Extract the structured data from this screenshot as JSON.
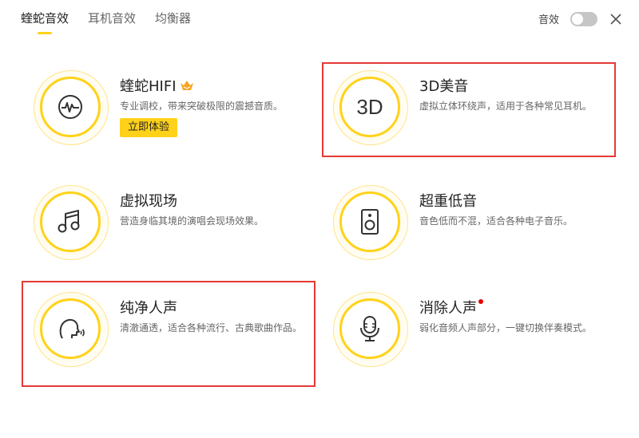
{
  "tabs": [
    {
      "label": "蝰蛇音效",
      "active": true
    },
    {
      "label": "耳机音效",
      "active": false
    },
    {
      "label": "均衡器",
      "active": false
    }
  ],
  "top_right": {
    "sound_label": "音效",
    "toggle_on": false,
    "close_icon": "close-icon"
  },
  "cards": [
    {
      "title": "蝰蛇HIFI",
      "desc": "专业调校，带来突破极限的震撼音质。",
      "icon": "waveform-icon",
      "button": "立即体验",
      "crown": "vip-crown-icon"
    },
    {
      "title": "3D美音",
      "desc": "虚拟立体环绕声，适用于各种常见耳机。",
      "icon": "3d-icon",
      "icon_text": "3D"
    },
    {
      "title": "虚拟现场",
      "desc": "营造身临其境的演唱会现场效果。",
      "icon": "music-note-icon"
    },
    {
      "title": "超重低音",
      "desc": "音色低而不混，适合各种电子音乐。",
      "icon": "speaker-icon"
    },
    {
      "title": "纯净人声",
      "desc": "清澈通透，适合各种流行、古典歌曲作品。",
      "icon": "voice-head-icon"
    },
    {
      "title": "消除人声",
      "desc": "弱化音频人声部分，一键切换伴奏模式。",
      "icon": "microphone-icon",
      "new_dot": true
    }
  ],
  "colors": {
    "accent": "#ffd21a",
    "highlight_box": "#e53935",
    "new_dot": "#e60000"
  }
}
